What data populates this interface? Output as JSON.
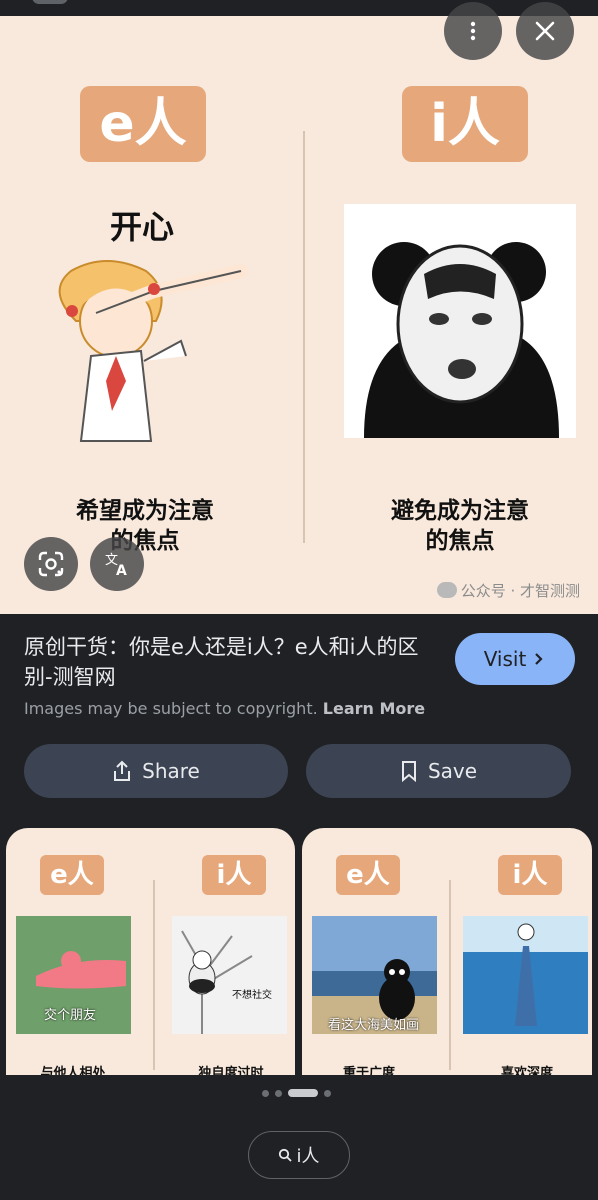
{
  "hero": {
    "tag_e": "e人",
    "tag_i": "i人",
    "left_heading": "开心",
    "left_caption_line1": "希望成为注意",
    "left_caption_line2": "的焦点",
    "right_caption_line1": "避免成为注意",
    "right_caption_line2": "的焦点",
    "watermark": "公众号 · 才智测测"
  },
  "overlay": {
    "menu_icon": "more-vert-icon",
    "close_icon": "close-icon",
    "lens_icon": "google-lens-icon",
    "translate_icon": "translate-icon"
  },
  "result": {
    "title": "原创干货：你是e人还是i人？e人和i人的区别-测智网",
    "visit_label": "Visit",
    "copyright_text": "Images may be subject to copyright.",
    "learn_more": "Learn More",
    "share_label": "Share",
    "save_label": "Save"
  },
  "related": [
    {
      "tag_e": "e人",
      "tag_i": "i人",
      "left_overlay": "交个朋友",
      "right_overlay": "不想社交",
      "left_caption": "与他人相处",
      "right_caption": "独自度过时"
    },
    {
      "tag_e": "e人",
      "tag_i": "i人",
      "left_overlay": "看这大海美如画",
      "left_caption": "重于广度",
      "right_caption": "喜欢深度"
    }
  ],
  "pagination": {
    "count": 4,
    "active_index": 2
  },
  "search_chip": {
    "label": "i人"
  },
  "colors": {
    "accent": "#8ab4f8",
    "tag": "#e6a77a",
    "panel": "#202124",
    "pill": "#3c4453",
    "peach": "#f8e9dc"
  }
}
